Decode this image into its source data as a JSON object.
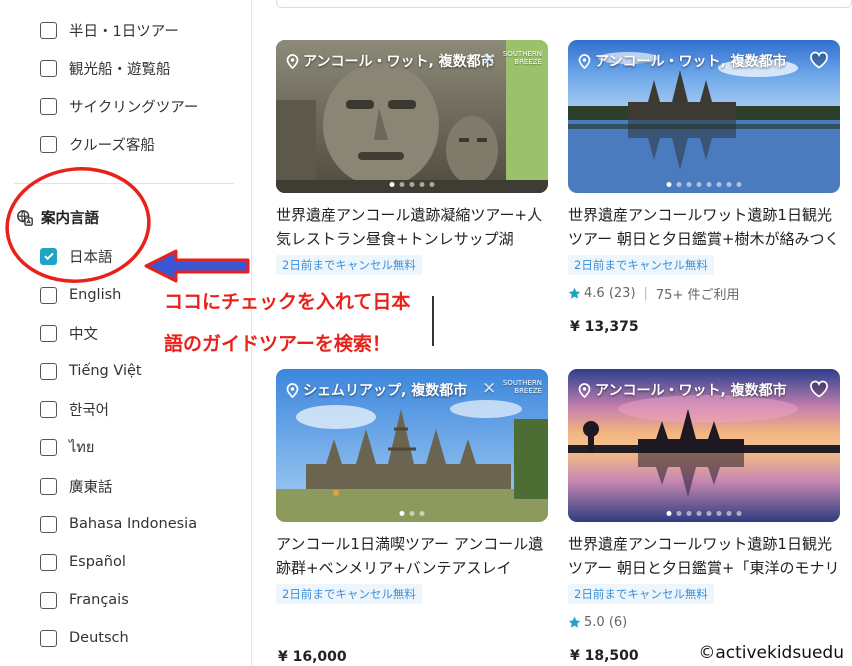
{
  "sidebar": {
    "tour_types": [
      {
        "label": "半日・1日ツアー",
        "checked": false
      },
      {
        "label": "観光船・遊覧船",
        "checked": false
      },
      {
        "label": "サイクリングツアー",
        "checked": false
      },
      {
        "label": "クルーズ客船",
        "checked": false
      }
    ],
    "language_section_title": "案内言語",
    "languages": [
      {
        "label": "日本語",
        "checked": true
      },
      {
        "label": "English",
        "checked": false
      },
      {
        "label": "中文",
        "checked": false
      },
      {
        "label": "Tiếng Việt",
        "checked": false
      },
      {
        "label": "한국어",
        "checked": false
      },
      {
        "label": "ไทย",
        "checked": false
      },
      {
        "label": "廣東話",
        "checked": false
      },
      {
        "label": "Bahasa Indonesia",
        "checked": false
      },
      {
        "label": "Español",
        "checked": false
      },
      {
        "label": "Français",
        "checked": false
      },
      {
        "label": "Deutsch",
        "checked": false
      }
    ]
  },
  "cards": [
    {
      "location": "アンコール・ワット, 複数都市",
      "brand_logo_text": "SOUTHERN BREEZE",
      "title": "世界遺産アンコール遺跡凝縮ツアー+人気レストラン昼食+トンレサップ湖",
      "badge": "2日前までキャンセル無料",
      "rating": "",
      "reviews": "",
      "booked": "",
      "price": "",
      "image_icon": "bayon-stone-face-image"
    },
    {
      "location": "アンコール・ワット, 複数都市",
      "brand_logo_text": "",
      "title": "世界遺産アンコールワット遺跡1日観光ツアー 朝日と夕日鑑賞+樹木が絡みつく遺跡",
      "badge": "2日前までキャンセル無料",
      "rating": "4.6",
      "reviews": "(23)",
      "booked": "75+ 件ご利用",
      "price": "¥ 13,375",
      "image_icon": "angkor-wat-reflection-image"
    },
    {
      "location": "シェムリアップ, 複数都市",
      "brand_logo_text": "SOUTHERN BREEZE",
      "title": "アンコール1日満喫ツアー アンコール遺跡群+ベンメリア+バンテアスレイ",
      "badge": "2日前までキャンセル無料",
      "rating": "",
      "reviews": "",
      "booked": "",
      "price": "¥ 16,000",
      "image_icon": "bayon-temple-image"
    },
    {
      "location": "アンコール・ワット, 複数都市",
      "brand_logo_text": "",
      "title": "世界遺産アンコールワット遺跡1日観光ツアー 朝日と夕日鑑賞+「東洋のモナリザ」",
      "badge": "2日前までキャンセル無料",
      "rating": "5.0",
      "reviews": "(6)",
      "booked": "",
      "price": "¥ 18,500",
      "image_icon": "angkor-wat-sunrise-image"
    }
  ],
  "annotation": {
    "line1": "ココにチェックを入れて日本",
    "line2": "語のガイドツアーを検索！",
    "color": "#e8221a"
  },
  "watermark": "©activekidsuedu",
  "colors": {
    "checkbox_accent": "#1fa5c4",
    "badge_text": "#3d8fd6",
    "badge_bg": "#eef6fd",
    "star": "#1fa5c4"
  }
}
